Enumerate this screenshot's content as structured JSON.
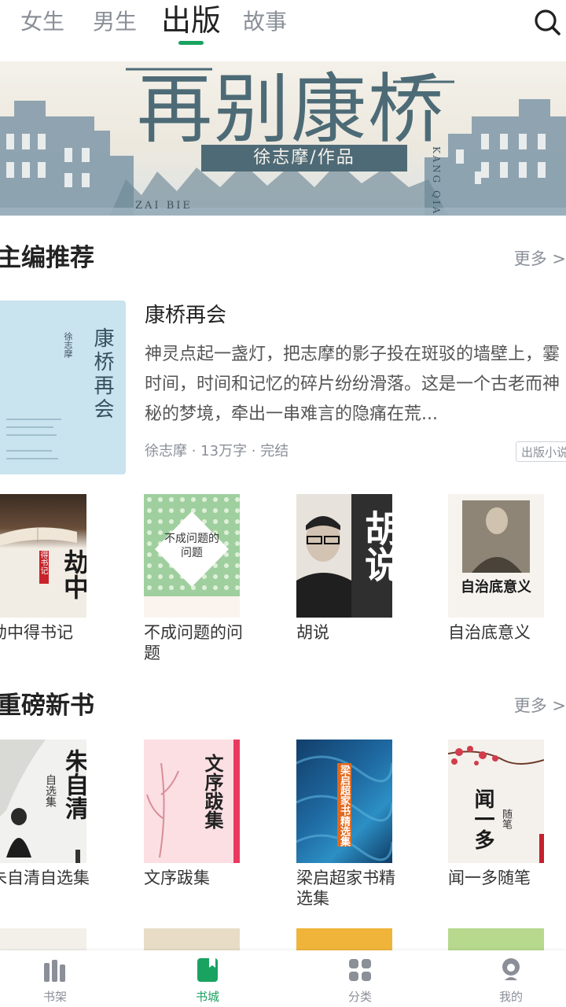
{
  "top_tabs": [
    {
      "label": "女生"
    },
    {
      "label": "男生"
    },
    {
      "label": "出版"
    },
    {
      "label": "故事"
    }
  ],
  "banner": {
    "title": "再别康桥",
    "pinyin_left": "ZAI BIE",
    "pinyin_right": "KANG QIAO",
    "author": "徐志摩/作品"
  },
  "editor_picks": {
    "title": "主编推荐",
    "more": "更多 >",
    "featured": {
      "name": "康桥再会",
      "cover_title": "康桥再会",
      "cover_author": "徐志摩",
      "description": "神灵点起一盏灯，把志摩的影子投在斑驳的墙壁上，霎时间，时间和记忆的碎片纷纷滑落。这是一个古老而神秘的梦境，牵出一串难言的隐痛在荒...",
      "meta": "徐志摩 · 13万字 · 完结",
      "tag": "出版小说"
    },
    "books": [
      {
        "title": "劫中得书记",
        "cover_text": "劫中",
        "cover_sub": "得书记"
      },
      {
        "title": "不成问题的问题",
        "cover_text": "不成问题的问题"
      },
      {
        "title": "胡说",
        "cover_text": "胡说"
      },
      {
        "title": "自治底意义",
        "cover_text": "自治底意义"
      }
    ]
  },
  "new_books": {
    "title": "重磅新书",
    "more": "更多 >",
    "books": [
      {
        "title": "朱自清自选集",
        "cover_text": "朱自清",
        "cover_sub": "自选集"
      },
      {
        "title": "文序跋集",
        "cover_text": "文序跋集"
      },
      {
        "title": "梁启超家书精选集",
        "cover_text": "梁启超家书精选集"
      },
      {
        "title": "闻一多随笔",
        "cover_text": "闻一多",
        "cover_sub": "随笔"
      }
    ]
  },
  "bottom_nav": [
    {
      "label": "书架",
      "icon": "bookshelf-icon"
    },
    {
      "label": "书城",
      "icon": "bookstore-icon",
      "active": true
    },
    {
      "label": "分类",
      "icon": "category-icon"
    },
    {
      "label": "我的",
      "icon": "profile-icon"
    }
  ],
  "colors": {
    "accent": "#1aa260",
    "text_primary": "#222222",
    "text_secondary": "#8a8f98"
  }
}
